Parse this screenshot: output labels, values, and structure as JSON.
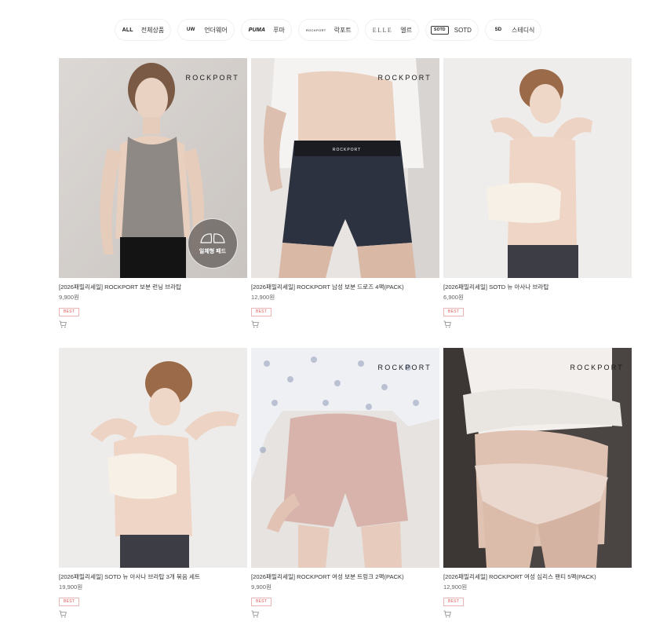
{
  "filters": [
    {
      "logo": "ALL",
      "label": "전체상품",
      "icon": "all-icon"
    },
    {
      "logo": "UW",
      "label": "언더웨어",
      "icon": "underwear-brand-icon"
    },
    {
      "logo": "PUMA",
      "label": "푸마",
      "icon": "puma-logo-icon"
    },
    {
      "logo": "ROCKPORT",
      "label": "락포트",
      "icon": "rockport-logo-icon"
    },
    {
      "logo": "ELLE",
      "label": "엘르",
      "icon": "elle-logo-icon"
    },
    {
      "logo": "SOTD",
      "label": "SOTD",
      "icon": "sotd-logo-icon"
    },
    {
      "logo": "SD",
      "label": "스테디식",
      "icon": "steady-logo-icon"
    }
  ],
  "products": [
    {
      "title": "[2026패밀리세일] ROCKPORT 보분 런닝 브라탑",
      "price": "9,900원",
      "badge": "BEST",
      "brand_mark": "ROCKPORT",
      "overlay_badge": "일체형 패드"
    },
    {
      "title": "[2026패밀리세일] ROCKPORT 남성 보분 드로즈 4팩(PACK)",
      "price": "12,900원",
      "badge": "BEST",
      "brand_mark": "ROCKPORT",
      "waistband_text": "ROCKPORT"
    },
    {
      "title": "[2026패밀리세일] SOTD 뉴 아사나 브라탑",
      "price": "6,900원",
      "badge": "BEST",
      "brand_mark": ""
    },
    {
      "title": "[2026패밀리세일] SOTD 뉴 아사나 브라탑 3개 묶음 세트",
      "price": "19,900원",
      "badge": "BEST",
      "brand_mark": ""
    },
    {
      "title": "[2026패밀리세일] ROCKPORT 여성 보분 트렁크 2팩(PACK)",
      "price": "9,900원",
      "badge": "BEST",
      "brand_mark": "ROCKPORT"
    },
    {
      "title": "[2026패밀리세일] ROCKPORT 여성 심리스 팬티 5팩(PACK)",
      "price": "12,900원",
      "badge": "BEST",
      "brand_mark": "ROCKPORT"
    }
  ],
  "colors": {
    "best_text": "#e05a5a",
    "best_border": "#e8b4b4"
  }
}
